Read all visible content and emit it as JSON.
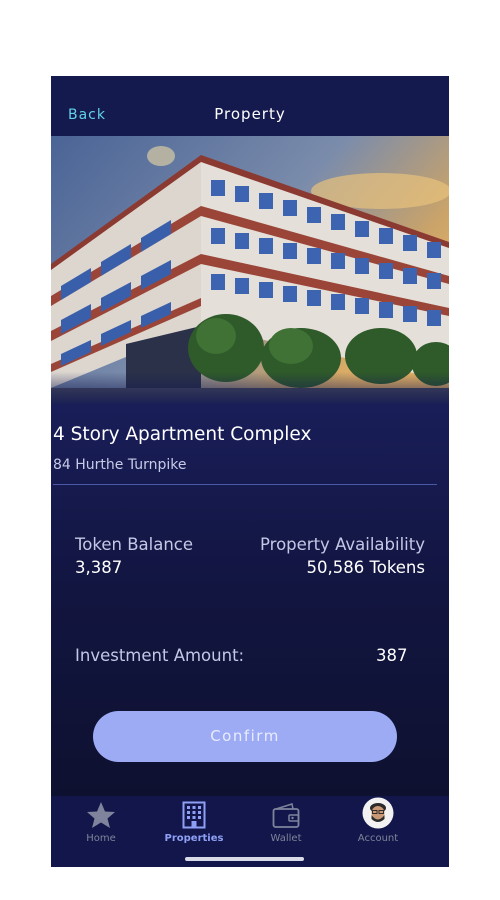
{
  "header": {
    "back_label": "Back",
    "title": "Property"
  },
  "property": {
    "image_icon": "apartment-building-photo",
    "title": "4 Story Apartment Complex",
    "address": "84 Hurthe Turnpike"
  },
  "stats": {
    "token_balance_label": "Token Balance",
    "token_balance_value": "3,387",
    "availability_label": "Property Availability",
    "availability_value": "50,586 Tokens"
  },
  "investment": {
    "label": "Investment Amount:",
    "value": "387"
  },
  "confirm_label": "Confirm",
  "tabbar": {
    "active": "Properties",
    "items": [
      {
        "label": "Home",
        "icon": "star-icon"
      },
      {
        "label": "Properties",
        "icon": "building-icon"
      },
      {
        "label": "Wallet",
        "icon": "wallet-icon"
      },
      {
        "label": "Account",
        "icon": "avatar-icon"
      }
    ]
  },
  "colors": {
    "accent": "#62d0e6",
    "button": "#9cabf3",
    "active_tab": "#8ea0f5",
    "background": "#151b52"
  }
}
